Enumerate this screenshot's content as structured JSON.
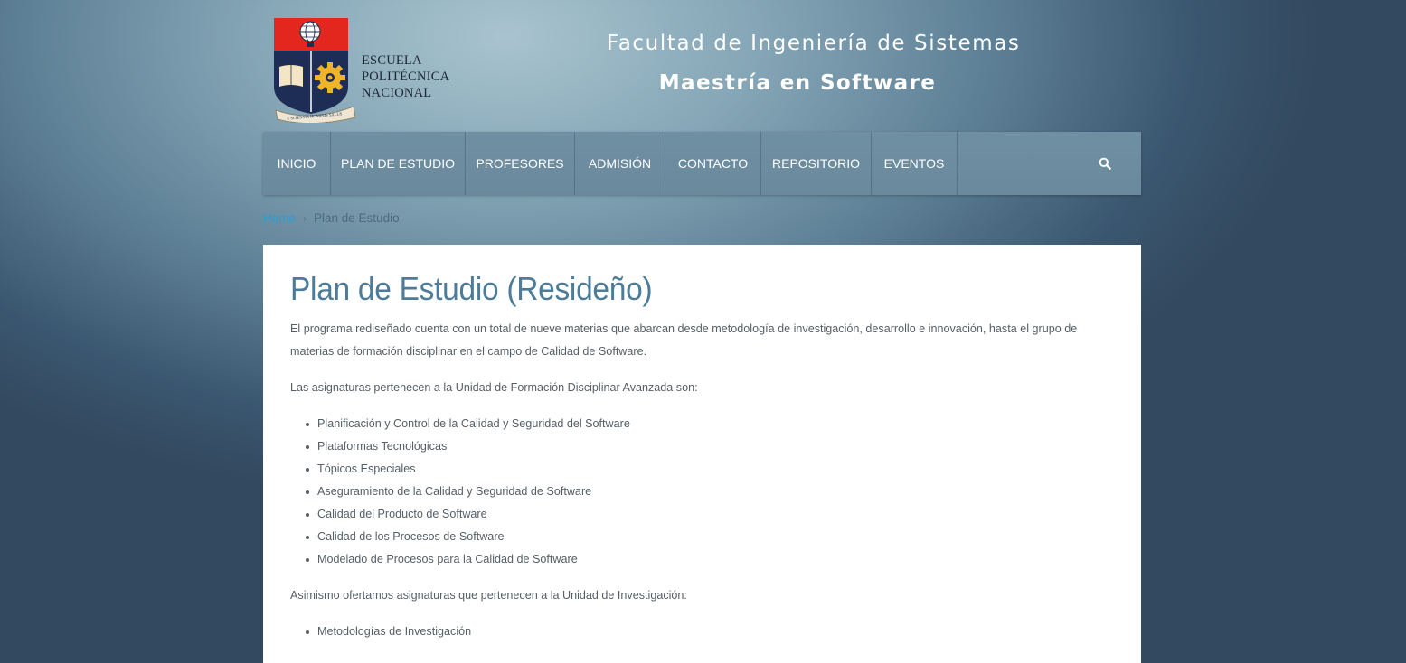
{
  "header": {
    "logo_lines": [
      "ESCUELA",
      "POLITÉCNICA",
      "NACIONAL"
    ],
    "logo_motto": "E SCIENTIA HOMINIS SALUS",
    "faculty": "Facultad de Ingeniería de Sistemas",
    "program": "Maestría en Software"
  },
  "nav": {
    "items": [
      {
        "label": "INICIO"
      },
      {
        "label": "PLAN DE ESTUDIO"
      },
      {
        "label": "PROFESORES"
      },
      {
        "label": "ADMISIÓN"
      },
      {
        "label": "CONTACTO"
      },
      {
        "label": "REPOSITORIO"
      },
      {
        "label": "EVENTOS"
      }
    ],
    "search_icon": "search-icon"
  },
  "breadcrumb": {
    "home": "Home",
    "separator": "›",
    "current": "Plan de Estudio"
  },
  "content": {
    "title": "Plan de Estudio (Resideño)",
    "intro": "El programa rediseñado cuenta con un total de nueve materias que abarcan desde metodología de investigación, desarrollo e innovación, hasta el grupo de materias de formación disciplinar en el campo de Calidad de Software.",
    "unit1_intro": "Las asignaturas pertenecen a la Unidad de Formación Disciplinar Avanzada son:",
    "unit1_items": [
      "Planificación y Control de la Calidad y Seguridad del Software",
      "Plataformas Tecnológicas",
      "Tópicos Especiales",
      "Aseguramiento de la Calidad y Seguridad de Software",
      "Calidad del Producto de Software",
      "Calidad de los Procesos de Software",
      "Modelado de Procesos para la Calidad de Software"
    ],
    "unit2_intro": "Asimismo ofertamos asignaturas que pertenecen a la Unidad de Investigación:",
    "unit2_items": [
      "Metodologías de Investigación"
    ]
  },
  "colors": {
    "title": "#4c7c99",
    "link": "#2f9bd6",
    "nav_bg": "#6c8ca0",
    "logo_red": "#e3261e",
    "logo_navy": "#1d2d55",
    "logo_gold": "#f0b429"
  }
}
